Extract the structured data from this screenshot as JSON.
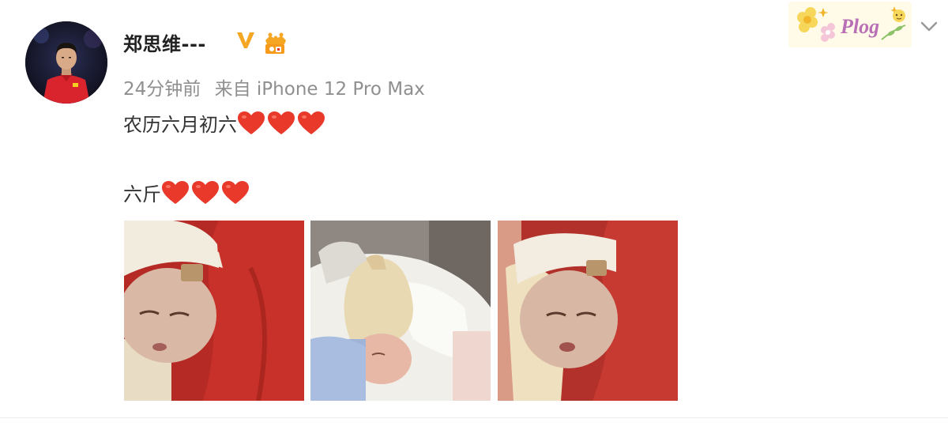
{
  "post": {
    "author": {
      "name": "郑思维---",
      "avatar_icon": "player-avatar",
      "verified_icon": "verified-v-icon",
      "member_icon": "crown-member-icon"
    },
    "meta": {
      "time": "24分钟前",
      "source": "来自 iPhone 12 Pro Max"
    },
    "text": {
      "line1": "农历六月初六",
      "line2": "六斤",
      "heart_emoji": "red-heart-icon",
      "heart_count_line1": 3,
      "heart_count_line2": 3
    },
    "badge_card": {
      "text": "Plog",
      "icon": "plog-flower-badge"
    },
    "menu_icon": "chevron-down-icon",
    "photos": [
      {
        "name": "photo-baby-red-blanket"
      },
      {
        "name": "photo-baby-sleeping"
      },
      {
        "name": "photo-baby-red-blanket-closeup"
      }
    ]
  },
  "colors": {
    "accent_orange": "#f5a623",
    "meta_gray": "#8f8f8f",
    "heart_red": "#e8392a",
    "text": "#333333"
  }
}
